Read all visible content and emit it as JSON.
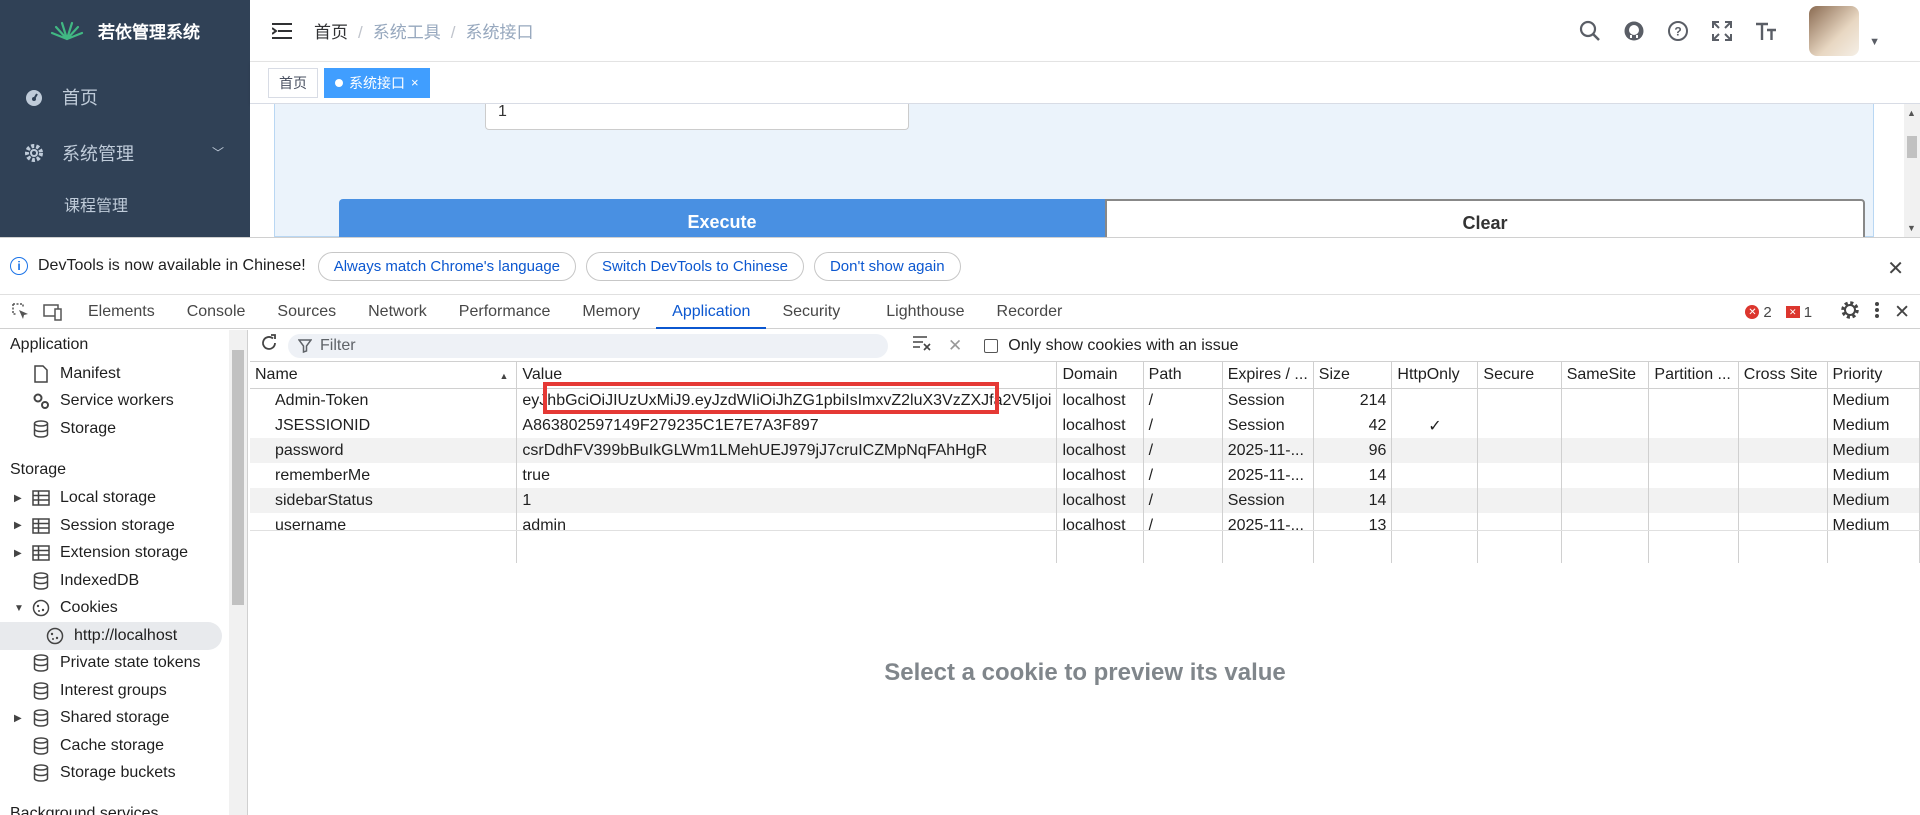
{
  "app": {
    "logo_text": "若依管理系统",
    "menu": [
      {
        "label": "首页"
      },
      {
        "label": "系统管理"
      }
    ],
    "submenu_partial": "课程管理",
    "breadcrumb": [
      "首页",
      "系统工具",
      "系统接口"
    ],
    "tags": [
      {
        "label": "首页"
      },
      {
        "label": "系统接口",
        "close": "×"
      }
    ],
    "input_value": "1",
    "execute_label": "Execute",
    "clear_label": "Clear"
  },
  "devtools": {
    "infobar": {
      "message": "DevTools is now available in Chinese!",
      "buttons": [
        "Always match Chrome's language",
        "Switch DevTools to Chinese",
        "Don't show again"
      ]
    },
    "tabs": [
      "Elements",
      "Console",
      "Sources",
      "Network",
      "Performance",
      "Memory",
      "Application",
      "Security",
      "Lighthouse",
      "Recorder"
    ],
    "active_tab": "Application",
    "error_count": "2",
    "warning_count": "1",
    "sidebar": {
      "application_title": "Application",
      "application_items": [
        "Manifest",
        "Service workers",
        "Storage"
      ],
      "storage_title": "Storage",
      "storage_items": [
        "Local storage",
        "Session storage",
        "Extension storage",
        "IndexedDB",
        "Cookies",
        "http://localhost",
        "Private state tokens",
        "Interest groups",
        "Shared storage",
        "Cache storage",
        "Storage buckets"
      ],
      "background_title": "Background services"
    },
    "toolbar": {
      "filter_placeholder": "Filter",
      "only_issue_label": "Only show cookies with an issue"
    },
    "table": {
      "headers": [
        "Name",
        "Value",
        "Domain",
        "Path",
        "Expires / ...",
        "Size",
        "HttpOnly",
        "Secure",
        "SameSite",
        "Partition ...",
        "Cross Site",
        "Priority"
      ],
      "rows": [
        [
          "Admin-Token",
          "eyJhbGciOiJIUzUxMiJ9.eyJzdWIiOiJhZG1pbiIsImxvZ2luX3VzZXJfa2V5Ijoi",
          "localhost",
          "/",
          "Session",
          "214",
          "",
          "",
          "",
          "",
          "",
          "Medium"
        ],
        [
          "JSESSIONID",
          "A863802597149F279235C1E7E7A3F897",
          "localhost",
          "/",
          "Session",
          "42",
          "✓",
          "",
          "",
          "",
          "",
          "Medium"
        ],
        [
          "password",
          "csrDdhFV399bBuIkGLWm1LMehUEJ979jJ7cruICZMpNqFAhHgR",
          "localhost",
          "/",
          "2025-11-...",
          "96",
          "",
          "",
          "",
          "",
          "",
          "Medium"
        ],
        [
          "rememberMe",
          "true",
          "localhost",
          "/",
          "2025-11-...",
          "14",
          "",
          "",
          "",
          "",
          "",
          "Medium"
        ],
        [
          "sidebarStatus",
          "1",
          "localhost",
          "/",
          "Session",
          "14",
          "",
          "",
          "",
          "",
          "",
          "Medium"
        ],
        [
          "username",
          "admin",
          "localhost",
          "/",
          "2025-11-...",
          "13",
          "",
          "",
          "",
          "",
          "",
          "Medium"
        ]
      ]
    },
    "preview_message": "Select a cookie to preview its value"
  }
}
